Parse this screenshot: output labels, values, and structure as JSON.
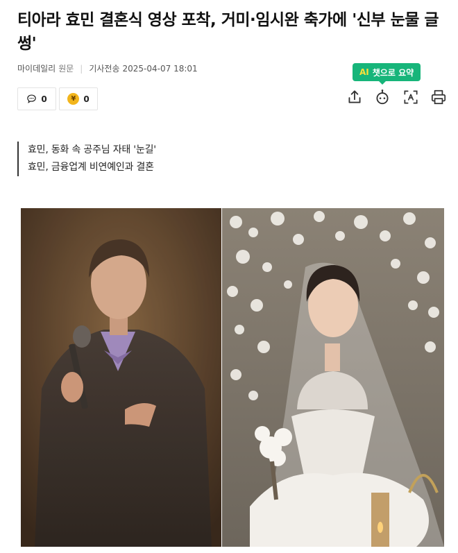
{
  "article": {
    "headline": "티아라 효민 결혼식 영상 포착, 거미·임시완 축가에 '신부 눈물 글썽'",
    "source": "마이데일리",
    "origin_label": "원문",
    "sent_label": "기사전송",
    "timestamp": "2025-04-07 18:01"
  },
  "reactions": {
    "comment_count": "0",
    "like_count": "0",
    "coin_symbol": "¥"
  },
  "toolbar": {
    "ai_badge_mark": "AI",
    "ai_badge_text": "챗으로 요약"
  },
  "summary": [
    "효민, 동화 속 공주님 자태 '눈길'",
    "효민, 금융업계 비연예인과 결혼"
  ],
  "colors": {
    "ai_badge": "#17b57a",
    "coin": "#f2b51c"
  }
}
